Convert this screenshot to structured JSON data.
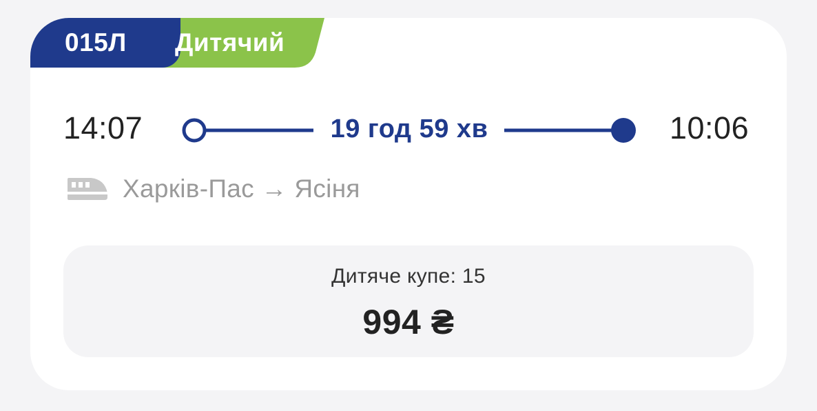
{
  "train": {
    "number": "015Л",
    "type": "Дитячий",
    "number_color": "#1f3a8c",
    "type_color": "#8bc34a"
  },
  "schedule": {
    "departure_time": "14:07",
    "arrival_time": "10:06",
    "duration": "19 год 59 хв"
  },
  "route": {
    "icon": "train-icon",
    "text": "Харків-Пас → Ясіня"
  },
  "seat": {
    "label": "Дитяче купе: 15",
    "price": "994 ₴"
  },
  "colors": {
    "accent": "#1f3a8c",
    "badge_green": "#8bc34a",
    "muted_text": "#9a9a9a",
    "background": "#f4f4f6"
  }
}
